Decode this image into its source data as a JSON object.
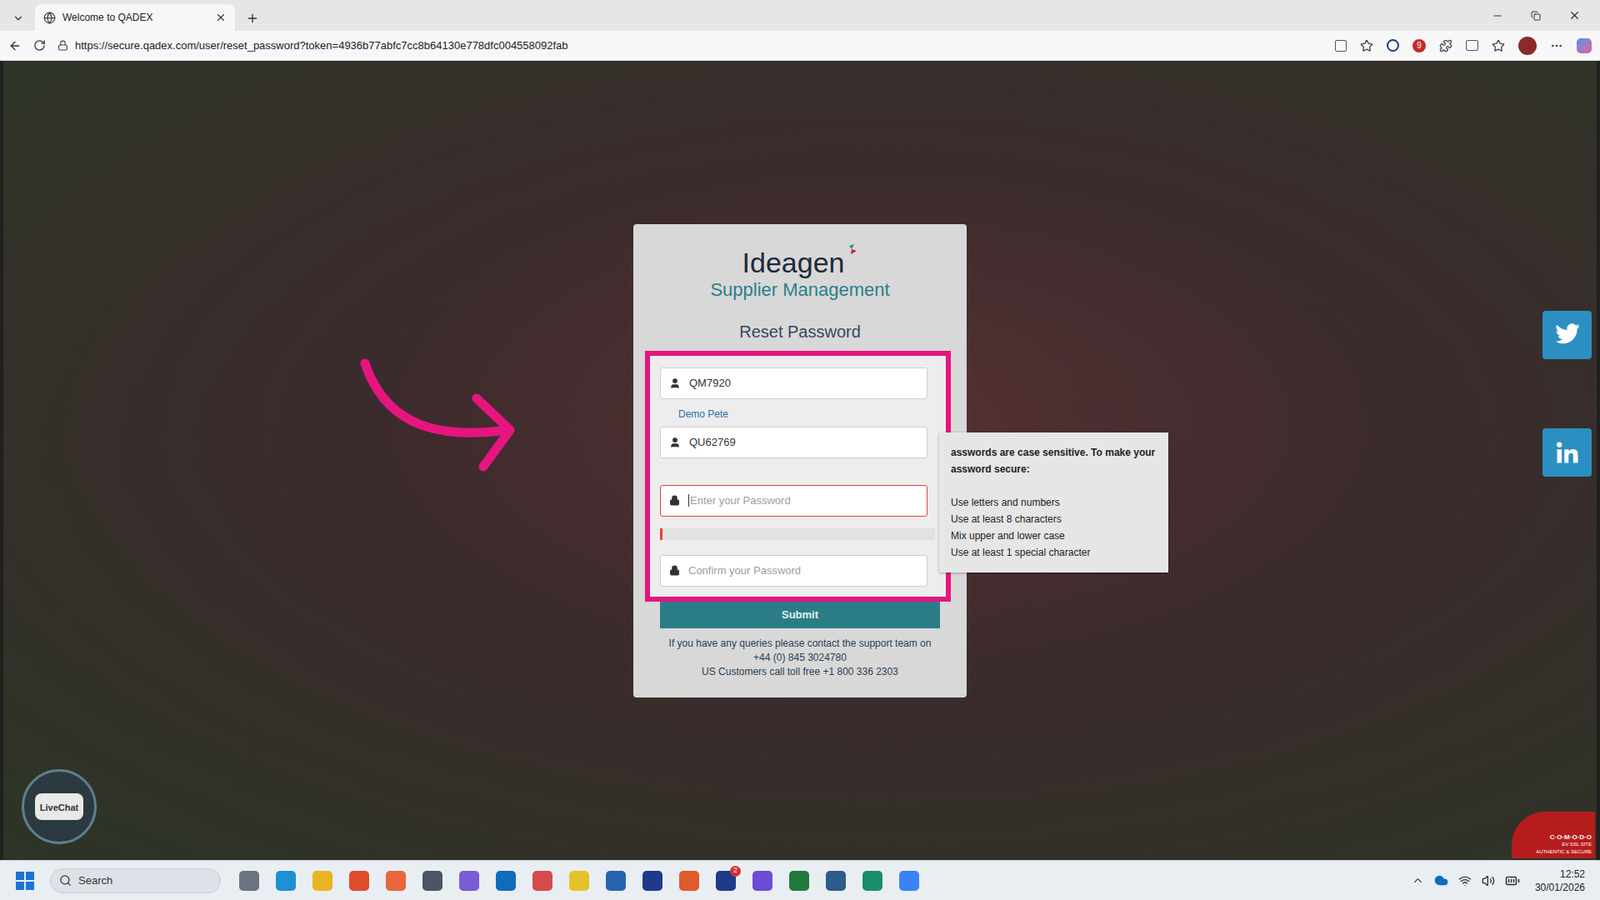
{
  "browser": {
    "tab": {
      "title": "Welcome to QADEX",
      "selected": true
    },
    "url": "https://secure.qadex.com/user/reset_password?token=4936b77abfc7cc8b64130e778dfc004558092fab",
    "extension_badge": "9"
  },
  "logo": {
    "brand": "Ideagen",
    "product": "Supplier Management"
  },
  "heading": "Reset Password",
  "account": {
    "code": "QM7920",
    "name": "Demo Pete"
  },
  "username": {
    "value": "QU62769"
  },
  "password": {
    "placeholder": "Enter your Password",
    "value": "",
    "focused": true,
    "strength": 0.01
  },
  "confirm": {
    "placeholder": "Confirm your Password",
    "value": "",
    "focused": false
  },
  "submit": "Submit",
  "support": [
    "If you have any queries please contact the support team on",
    "+44 (0) 845 3024780",
    "US Customers call toll free +1 800 336 2303"
  ],
  "tooltip": {
    "intro": [
      "asswords are case sensitive. To make your",
      "assword secure:"
    ],
    "rules": [
      "Use letters and numbers",
      "Use at least 8 characters",
      "Mix upper and lower case",
      "Use at least 1 special character"
    ]
  },
  "livechat": "LiveChat",
  "ssl_badge": [
    "C·O·M·O·D·O",
    "EV SSL SITE",
    "AUTHENTIC & SECURE"
  ],
  "taskbar": {
    "search": "Search",
    "badge": "2",
    "time": "12:52",
    "date": "30/01/2026"
  }
}
